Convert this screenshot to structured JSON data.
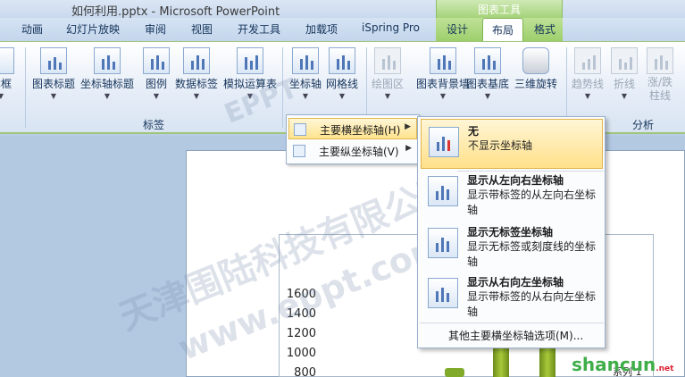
{
  "window": {
    "title": "如何利用.pptx - Microsoft PowerPoint",
    "context_header": "图表工具"
  },
  "tabs": [
    "动画",
    "幻灯片放映",
    "审阅",
    "视图",
    "开发工具",
    "加载项",
    "iSpring Pro",
    "设计",
    "布局",
    "格式"
  ],
  "active_tab": "布局",
  "ribbon": {
    "buttons": [
      "本框",
      "图表标题",
      "坐标轴标题",
      "图例",
      "数据标签",
      "模拟运算表",
      "坐标轴",
      "网格线",
      "绘图区",
      "图表背景墙",
      "图表基底",
      "三维旋转",
      "趋势线",
      "折线",
      "涨/跌",
      "柱线"
    ],
    "groups": {
      "labels": "标签",
      "analysis": "分析"
    }
  },
  "submenu": {
    "items": [
      "主要横坐标轴(H)",
      "主要纵坐标轴(V)"
    ]
  },
  "dropdown": {
    "items": [
      {
        "title": "无",
        "desc": "不显示坐标轴"
      },
      {
        "title": "显示从左向右坐标轴",
        "desc": "显示带标签的从左向右坐标轴"
      },
      {
        "title": "显示无标签坐标轴",
        "desc": "显示无标签或刻度线的坐标轴"
      },
      {
        "title": "显示从右向左坐标轴",
        "desc": "显示带标签的从右向左坐标轴"
      }
    ],
    "more": "其他主要横坐标轴选项(M)..."
  },
  "chart": {
    "y_ticks": [
      "1600",
      "1400",
      "1200",
      "1000",
      "800"
    ],
    "legend": "系列 1"
  },
  "watermarks": [
    "天津围陆科技有限公司",
    "www.eppt.com",
    "EPPT"
  ],
  "logo": {
    "text": "shancun",
    "sub": ".net"
  }
}
